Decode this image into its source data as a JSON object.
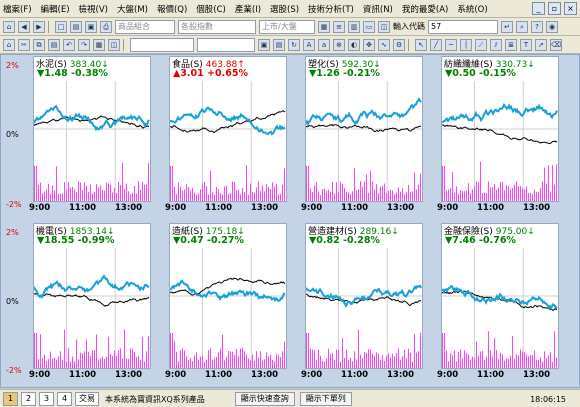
{
  "menu": [
    "檔案(F)",
    "編輯(E)",
    "檢視(V)",
    "大盤(M)",
    "報價(Q)",
    "個股(C)",
    "產業(I)",
    "選股(S)",
    "技術分析(T)",
    "資訊(N)",
    "我的最愛(A)",
    "系統(O)"
  ],
  "toolbar": {
    "combo1_placeholder": "商品組合",
    "combo2_placeholder": "各股指數",
    "combo3_placeholder": "上市/大盤",
    "input_label": "輸入代碼",
    "input_value": "57"
  },
  "axis": {
    "top": "2%",
    "mid": "0%",
    "bottom": "-2%"
  },
  "time_ticks": [
    "9:00",
    "11:00",
    "13:00"
  ],
  "colors": {
    "up": "#e00000",
    "down": "#008000",
    "index_line": "#19a0d8",
    "avg_line": "#000000",
    "volume": "#ff40ff"
  },
  "panels": [
    {
      "name": "水泥(S)",
      "value": "383.40↓",
      "dir": "down",
      "change": "▼1.48 -0.38%"
    },
    {
      "name": "食品(S)",
      "value": "463.88↑",
      "dir": "up",
      "change": "▲3.01 +0.65%"
    },
    {
      "name": "塑化(S)",
      "value": "592.30↓",
      "dir": "down",
      "change": "▼1.26 -0.21%"
    },
    {
      "name": "紡織纖維(S)",
      "value": "330.73↓",
      "dir": "down",
      "change": "▼0.50 -0.15%"
    },
    {
      "name": "機電(S)",
      "value": "1853.14↓",
      "dir": "down",
      "change": "▼18.55 -0.99%"
    },
    {
      "name": "造紙(S)",
      "value": "175.18↓",
      "dir": "down",
      "change": "▼0.47 -0.27%"
    },
    {
      "name": "營造建材(S)",
      "value": "289.16↓",
      "dir": "down",
      "change": "▼0.82 -0.28%"
    },
    {
      "name": "金融保險(S)",
      "value": "975.00↓",
      "dir": "down",
      "change": "▼7.46 -0.76%"
    }
  ],
  "status": {
    "tabs": [
      "1",
      "2",
      "3",
      "4"
    ],
    "mode": "交易",
    "message": "本系統為寶資訊XQ系列產品",
    "btn_query": "顯示快速查詢",
    "btn_list": "顯示下單列",
    "time": "18:06:15"
  }
}
